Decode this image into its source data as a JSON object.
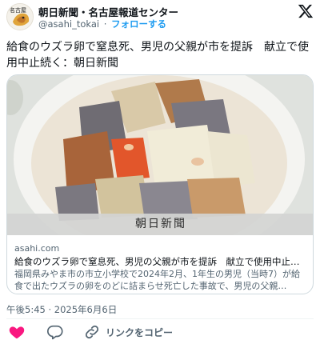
{
  "account": {
    "name": "朝日新聞・名古屋報道センター",
    "handle": "@asahi_tokai",
    "separator": "·",
    "follow_label": "フォローする",
    "avatar_text": "名古屋"
  },
  "tweet": {
    "text": "給食のウズラ卵で窒息死、男児の父親が市を提訴　献立で使用中止続く：朝日新聞",
    "timestamp": "午後5:45 · 2025年6月6日"
  },
  "card": {
    "brand": "朝日新聞",
    "domain": "asahi.com",
    "title": "給食のウズラ卵で窒息死、男児の父親が市を提訴　献立で使用中止続…",
    "description": "福岡県みやま市の市立小学校で2024年2月、1年生の男児（当時7）が給食で出たウズラの卵をのどに詰まらせ死亡した事故で、男児の父親…"
  },
  "actions": {
    "copy_link_label": "リンクをコピー"
  },
  "icons": {
    "brand": "x-logo-icon",
    "like": "heart-icon",
    "reply": "reply-icon",
    "link": "link-icon"
  },
  "colors": {
    "accent": "#1d9bf0",
    "like": "#f91880",
    "muted": "#536471",
    "text": "#0f1419"
  }
}
